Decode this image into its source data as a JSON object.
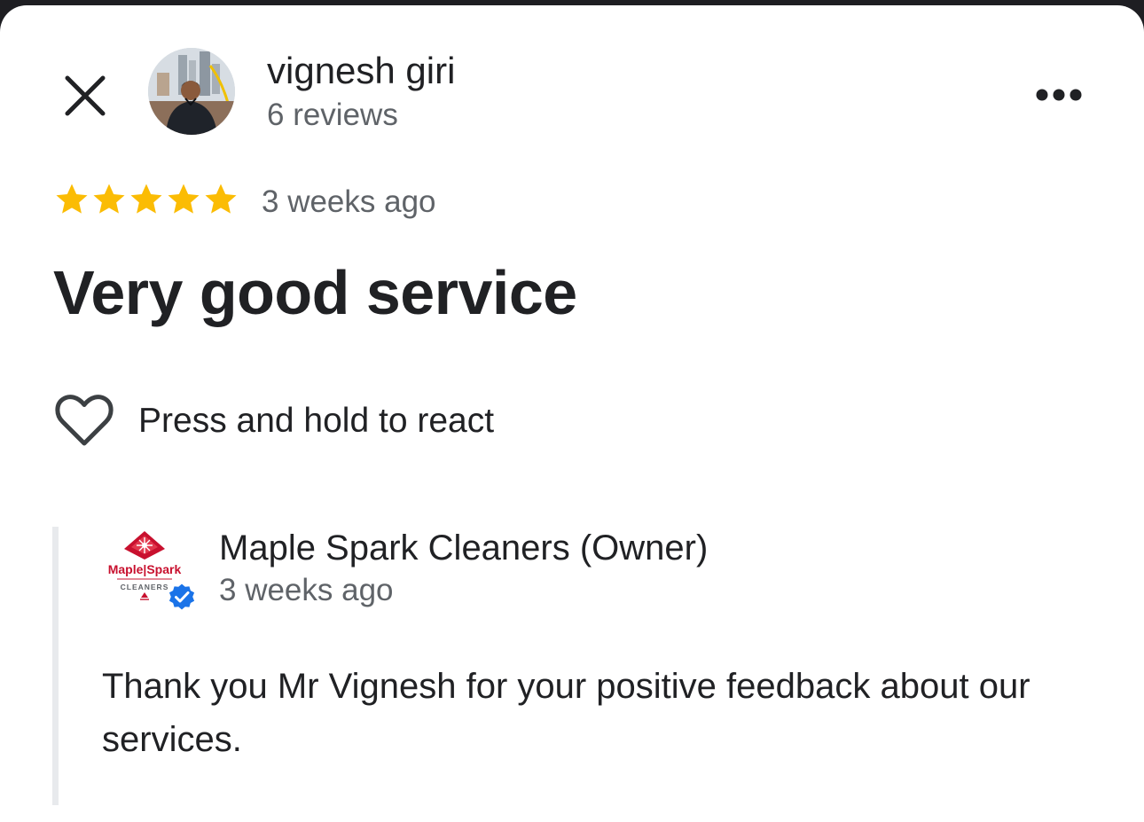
{
  "reviewer": {
    "name": "vignesh giri",
    "review_count": "6 reviews"
  },
  "review": {
    "rating": 5,
    "max_rating": 5,
    "time": "3 weeks ago",
    "title": "Very good service",
    "react_label": "Press and hold to react"
  },
  "owner_reply": {
    "name": "Maple Spark Cleaners (Owner)",
    "time": "3 weeks ago",
    "text": "Thank you Mr Vignesh for your positive feedback about our services.",
    "logo_text": "Maple Spark",
    "logo_subtext": "CLEANERS",
    "verified": true
  },
  "icons": {
    "close": "close-icon",
    "more": "more-horiz-icon",
    "star": "star-icon",
    "react": "heart-outline-icon",
    "verified": "verified-badge-icon"
  },
  "colors": {
    "star": "#fbbc04",
    "brand_red": "#c8102e",
    "verified_blue": "#1a73e8",
    "text_primary": "#202124",
    "text_secondary": "#5f6368"
  }
}
